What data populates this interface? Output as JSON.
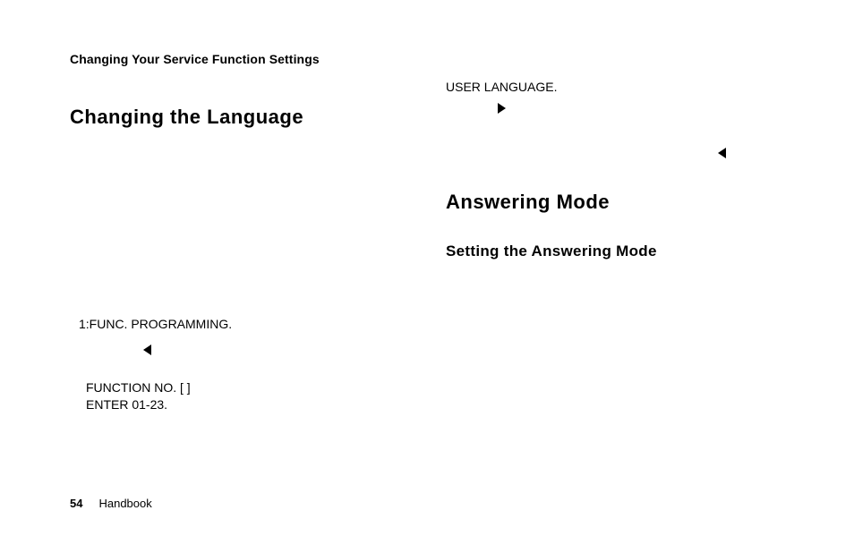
{
  "running_header": "Changing Your Service Function Settings",
  "left": {
    "heading": "Changing the Language",
    "lcd1": "1:FUNC. PROGRAMMING.",
    "lcd2_line1": "FUNCTION NO. [ ]",
    "lcd2_line2": "ENTER 01-23."
  },
  "right": {
    "lcd1": "USER LANGUAGE.",
    "heading1": "Answering Mode",
    "heading2": "Setting the Answering Mode"
  },
  "footer": {
    "page_number": "54",
    "book_title": "Handbook"
  }
}
